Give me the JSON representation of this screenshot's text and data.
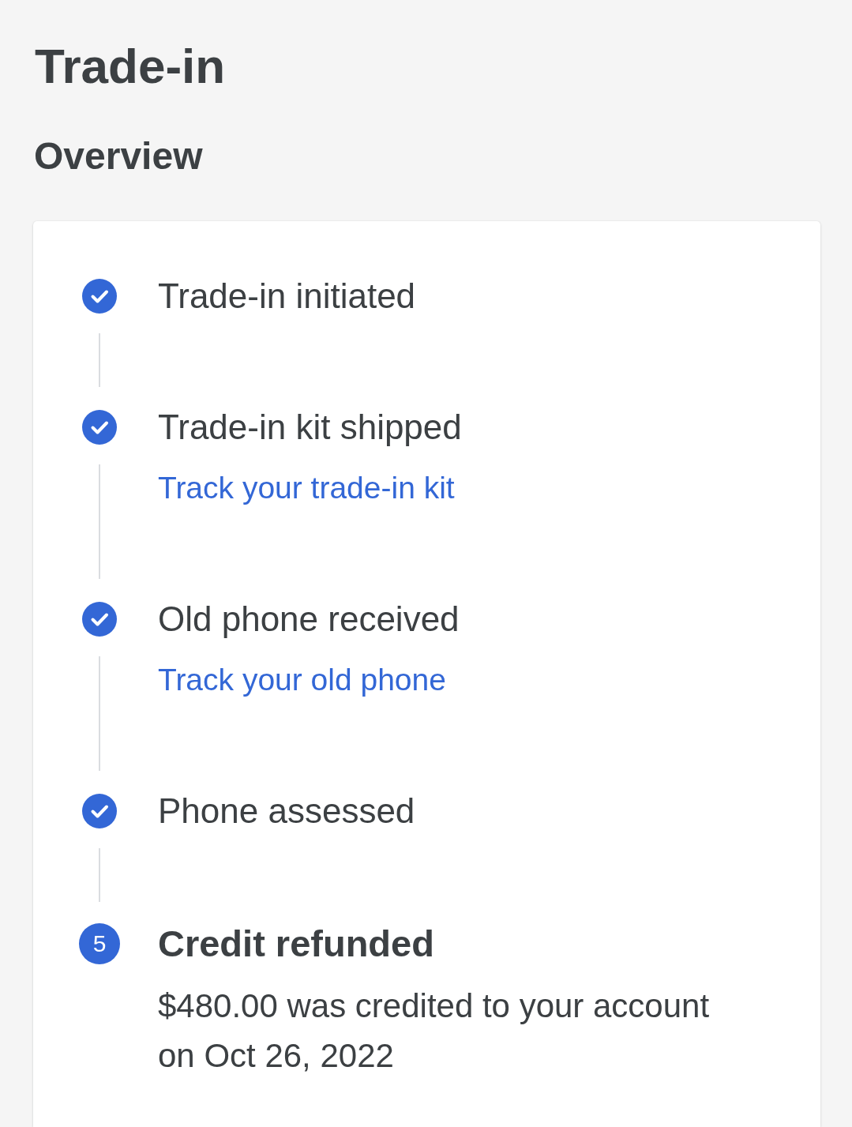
{
  "page": {
    "title": "Trade-in",
    "section_title": "Overview"
  },
  "steps": [
    {
      "kind": "done",
      "title": "Trade-in initiated"
    },
    {
      "kind": "done",
      "title": "Trade-in kit shipped",
      "link": "Track your trade-in kit"
    },
    {
      "kind": "done",
      "title": "Old phone received",
      "link": "Track your old phone"
    },
    {
      "kind": "done",
      "title": "Phone assessed"
    },
    {
      "kind": "current",
      "number": "5",
      "title": "Credit refunded",
      "description": "$480.00 was credited to your account on Oct 26, 2022"
    }
  ]
}
